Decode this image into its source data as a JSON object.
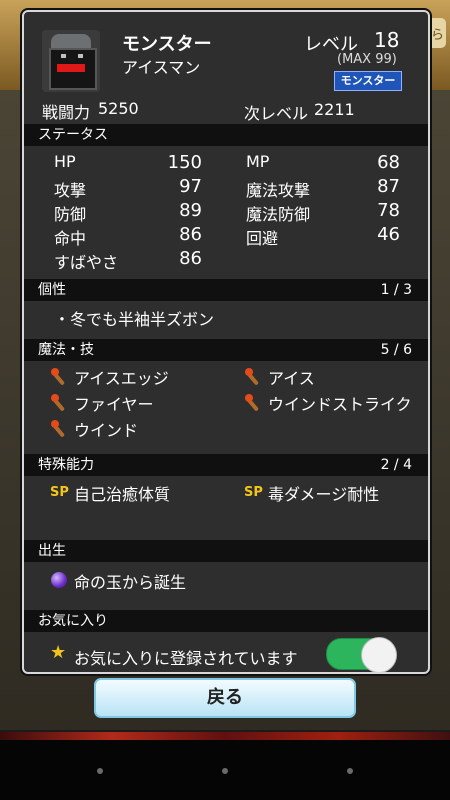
{
  "monster": {
    "name": "モンスター",
    "subname": "アイスマン",
    "level_label": "レベル",
    "level": "18",
    "max_level": "(MAX 99)",
    "type_badge": "モンスター",
    "power_label": "戦闘力",
    "power": "5250",
    "next_label": "次レベル",
    "next": "2211"
  },
  "status": {
    "title": "ステータス",
    "left": [
      {
        "label": "HP",
        "value": "150"
      },
      {
        "label": "攻撃",
        "value": "97"
      },
      {
        "label": "防御",
        "value": "89"
      },
      {
        "label": "命中",
        "value": "86"
      },
      {
        "label": "すばやさ",
        "value": "86"
      }
    ],
    "right": [
      {
        "label": "MP",
        "value": "68"
      },
      {
        "label": "魔法攻撃",
        "value": "87"
      },
      {
        "label": "魔法防御",
        "value": "78"
      },
      {
        "label": "回避",
        "value": "46"
      }
    ]
  },
  "trait": {
    "title": "個性",
    "count": "1 / 3",
    "items": [
      "・冬でも半袖半ズボン"
    ]
  },
  "magic": {
    "title": "魔法・技",
    "count": "5 / 6",
    "items": [
      "アイスエッジ",
      "アイス",
      "ファイヤー",
      "ウインドストライク",
      "ウインド"
    ]
  },
  "special": {
    "title": "特殊能力",
    "count": "2 / 4",
    "sp_label": "SP",
    "items": [
      "自己治癒体質",
      "毒ダメージ耐性"
    ]
  },
  "birth": {
    "title": "出生",
    "text": "命の玉から誕生"
  },
  "favorite": {
    "title": "お気に入り",
    "text": "お気に入りに登録されています",
    "enabled": true,
    "toggle_color": "#2db55d"
  },
  "back_button": "戻る",
  "bg": {
    "corner_text": "ら"
  },
  "colors": {
    "panel": "#2e2e2e",
    "header": "#101010",
    "badge": "#1f55b8",
    "accent": "#f3c51a"
  }
}
